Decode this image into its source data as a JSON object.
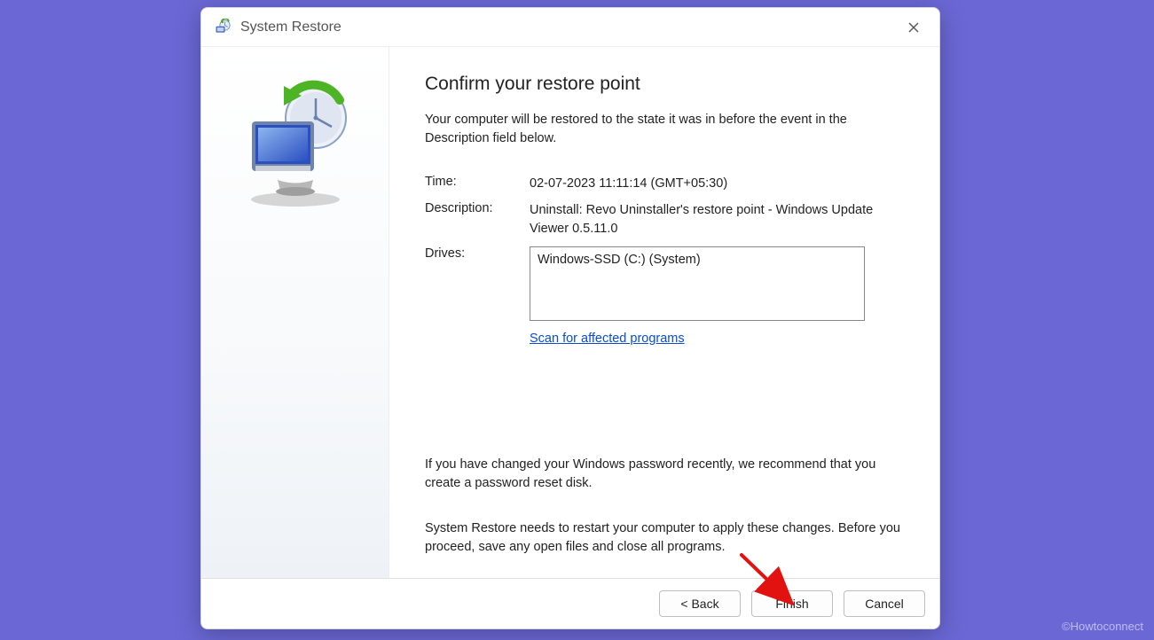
{
  "window": {
    "title": "System Restore"
  },
  "content": {
    "heading": "Confirm your restore point",
    "subtext": "Your computer will be restored to the state it was in before the event in the Description field below.",
    "time_label": "Time:",
    "time_value": "02-07-2023 11:11:14 (GMT+05:30)",
    "desc_label": "Description:",
    "desc_value": "Uninstall: Revo Uninstaller's restore point - Windows Update Viewer 0.5.11.0",
    "drives_label": "Drives:",
    "drives_value": "Windows-SSD (C:) (System)",
    "scan_link": "Scan for affected programs",
    "note1": "If you have changed your Windows password recently, we recommend that you create a password reset disk.",
    "note2": "System Restore needs to restart your computer to apply these changes. Before you proceed, save any open files and close all programs."
  },
  "buttons": {
    "back": "< Back",
    "finish": "Finish",
    "cancel": "Cancel"
  },
  "watermark": "©Howtoconnect"
}
